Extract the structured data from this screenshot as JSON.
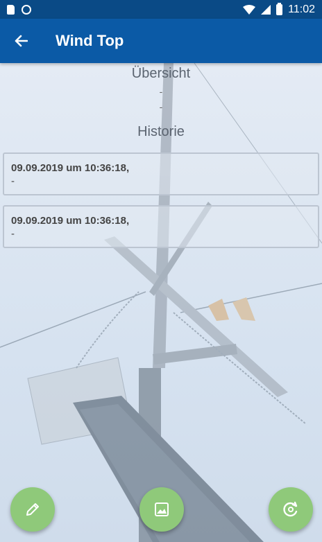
{
  "status_bar": {
    "time": "11:02"
  },
  "app_bar": {
    "title": "Wind Top"
  },
  "overview": {
    "heading": "Übersicht",
    "line1": "-",
    "line2": "-"
  },
  "history": {
    "heading": "Historie",
    "entries": [
      {
        "date": "09.09.2019 um 10:36:18,",
        "value": "-"
      },
      {
        "date": "09.09.2019 um 10:36:18,",
        "value": "-"
      }
    ]
  },
  "colors": {
    "appbar": "#0b5aa6",
    "statusbar": "#0a4a86",
    "fab": "#8fc97a"
  },
  "icons": [
    "arrow-back-icon",
    "pencil-icon",
    "image-icon",
    "refresh-icon"
  ]
}
